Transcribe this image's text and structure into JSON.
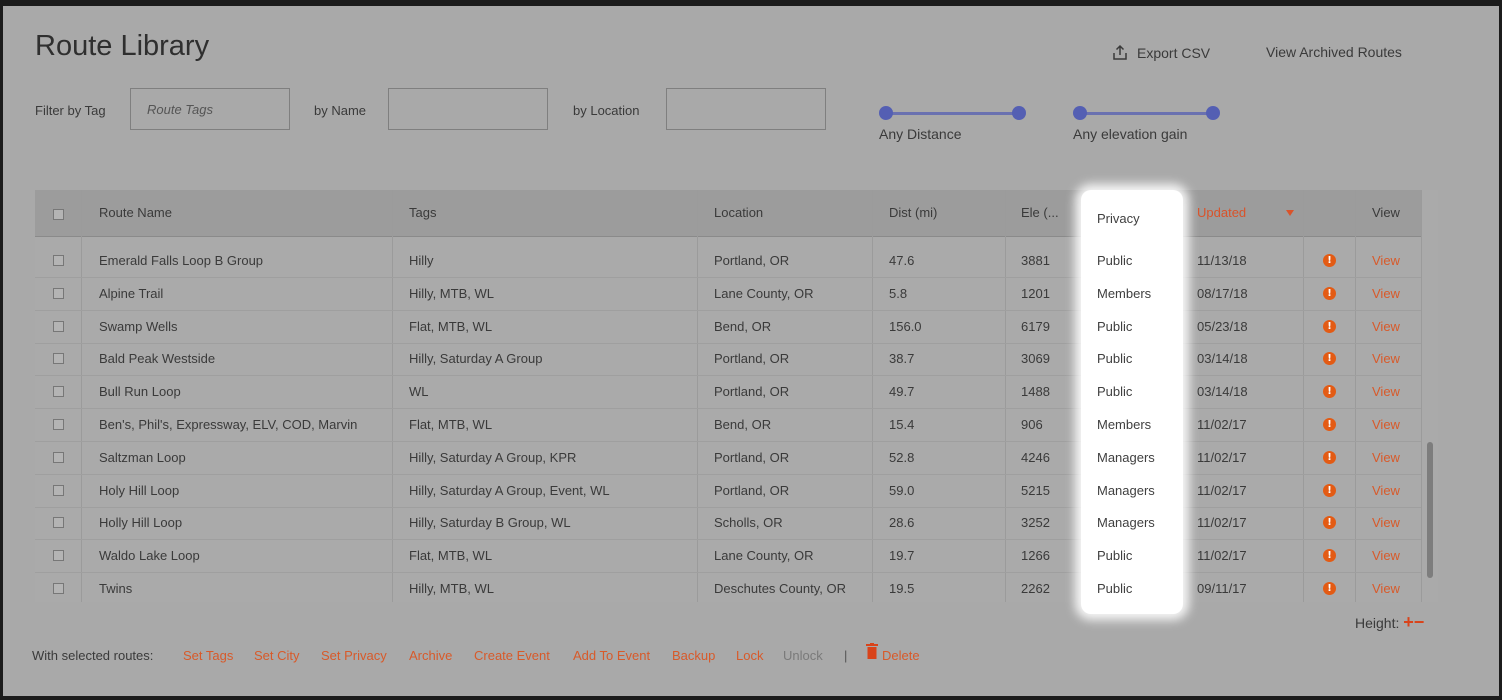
{
  "page": {
    "title": "Route Library"
  },
  "actions": {
    "export_csv": "Export CSV",
    "view_archived": "View Archived Routes"
  },
  "filters": {
    "tag_label": "Filter by Tag",
    "tag_placeholder": "Route Tags",
    "name_label": "by Name",
    "name_value": "",
    "location_label": "by Location",
    "location_value": "",
    "distance_label": "Any Distance",
    "elevation_label": "Any elevation gain"
  },
  "table": {
    "headers": {
      "route_name": "Route Name",
      "tags": "Tags",
      "location": "Location",
      "dist": "Dist (mi)",
      "ele": "Ele (...",
      "privacy": "Privacy",
      "updated": "Updated",
      "view": "View"
    },
    "sort": {
      "column": "updated",
      "direction": "desc",
      "color": "#d9532a"
    },
    "rows": [
      {
        "name": "Emerald Falls Loop B Group",
        "tags": "Hilly",
        "location": "Portland, OR",
        "dist": "47.6",
        "ele": "3881",
        "privacy": "Public",
        "updated": "11/13/18",
        "view": "View"
      },
      {
        "name": "Alpine Trail",
        "tags": "Hilly, MTB, WL",
        "location": "Lane County, OR",
        "dist": "5.8",
        "ele": "1201",
        "privacy": "Members",
        "updated": "08/17/18",
        "view": "View"
      },
      {
        "name": "Swamp Wells",
        "tags": "Flat, MTB, WL",
        "location": "Bend, OR",
        "dist": "156.0",
        "ele": "6179",
        "privacy": "Public",
        "updated": "05/23/18",
        "view": "View"
      },
      {
        "name": "Bald Peak Westside",
        "tags": "Hilly, Saturday A Group",
        "location": "Portland, OR",
        "dist": "38.7",
        "ele": "3069",
        "privacy": "Public",
        "updated": "03/14/18",
        "view": "View"
      },
      {
        "name": "Bull Run Loop",
        "tags": "WL",
        "location": "Portland, OR",
        "dist": "49.7",
        "ele": "1488",
        "privacy": "Public",
        "updated": "03/14/18",
        "view": "View"
      },
      {
        "name": "Ben's, Phil's, Expressway, ELV, COD, Marvin",
        "tags": "Flat, MTB, WL",
        "location": "Bend, OR",
        "dist": "15.4",
        "ele": "906",
        "privacy": "Members",
        "updated": "11/02/17",
        "view": "View"
      },
      {
        "name": "Saltzman Loop",
        "tags": "Hilly, Saturday A Group, KPR",
        "location": "Portland, OR",
        "dist": "52.8",
        "ele": "4246",
        "privacy": "Managers",
        "updated": "11/02/17",
        "view": "View"
      },
      {
        "name": "Holy Hill Loop",
        "tags": "Hilly, Saturday A Group, Event, WL",
        "location": "Portland, OR",
        "dist": "59.0",
        "ele": "5215",
        "privacy": "Managers",
        "updated": "11/02/17",
        "view": "View"
      },
      {
        "name": "Holly Hill Loop",
        "tags": "Hilly, Saturday B Group, WL",
        "location": "Scholls, OR",
        "dist": "28.6",
        "ele": "3252",
        "privacy": "Managers",
        "updated": "11/02/17",
        "view": "View"
      },
      {
        "name": "Waldo Lake Loop",
        "tags": "Flat, MTB, WL",
        "location": "Lane County, OR",
        "dist": "19.7",
        "ele": "1266",
        "privacy": "Public",
        "updated": "11/02/17",
        "view": "View"
      },
      {
        "name": "Twins",
        "tags": "Hilly, MTB, WL",
        "location": "Deschutes County, OR",
        "dist": "19.5",
        "ele": "2262",
        "privacy": "Public",
        "updated": "09/11/17",
        "view": "View"
      }
    ]
  },
  "height_control": {
    "label": "Height:",
    "plus": "+",
    "minus": "−"
  },
  "bulk_actions": {
    "label": "With selected routes:",
    "items": [
      "Set Tags",
      "Set City",
      "Set Privacy",
      "Archive",
      "Create Event",
      "Add To Event",
      "Backup",
      "Lock",
      "Unlock"
    ],
    "separator": "|",
    "delete": "Delete"
  },
  "colors": {
    "accent": "#d85a2a",
    "slider": "#545fb3",
    "info": "#e35b14"
  }
}
